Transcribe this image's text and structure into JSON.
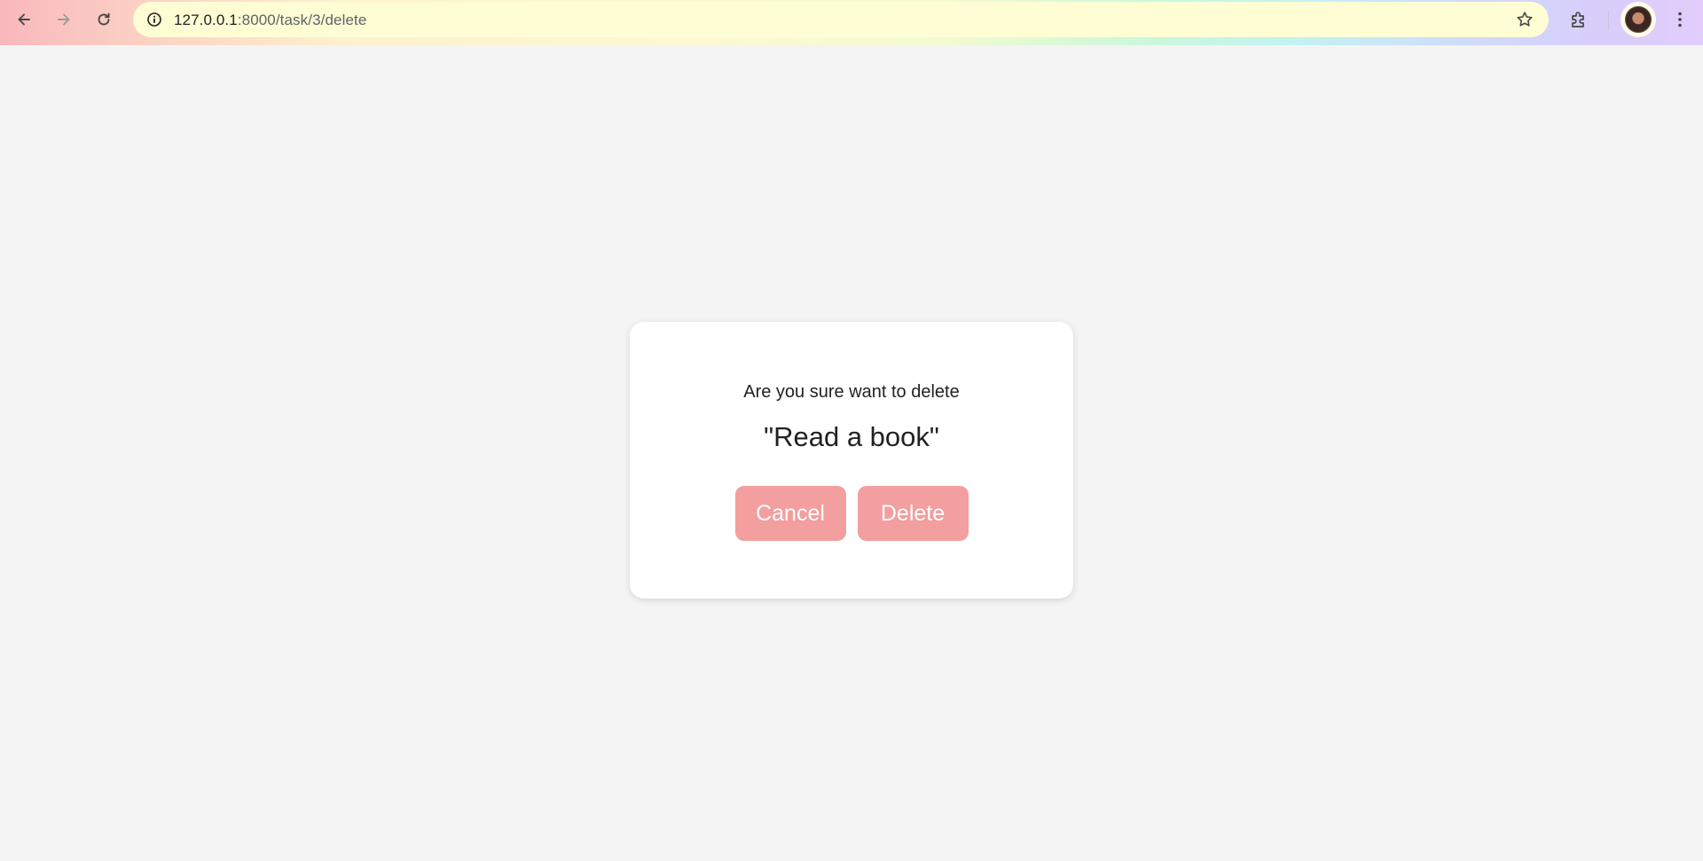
{
  "browser": {
    "url_host": "127.0.0.1",
    "url_path": ":8000/task/3/delete",
    "icons": {
      "back": "arrow-left-icon",
      "forward": "arrow-right-icon",
      "reload": "reload-icon",
      "site_info": "info-icon",
      "bookmark": "star-icon",
      "extensions": "puzzle-icon",
      "profile": "avatar",
      "menu": "kebab-menu-icon"
    }
  },
  "dialog": {
    "question": "Are you sure want to delete",
    "task_name": "\"Read a book\"",
    "cancel_label": "Cancel",
    "delete_label": "Delete"
  },
  "colors": {
    "page_background": "#f4f4f4",
    "button_background": "#f39e9f",
    "button_text": "#ffffff"
  }
}
